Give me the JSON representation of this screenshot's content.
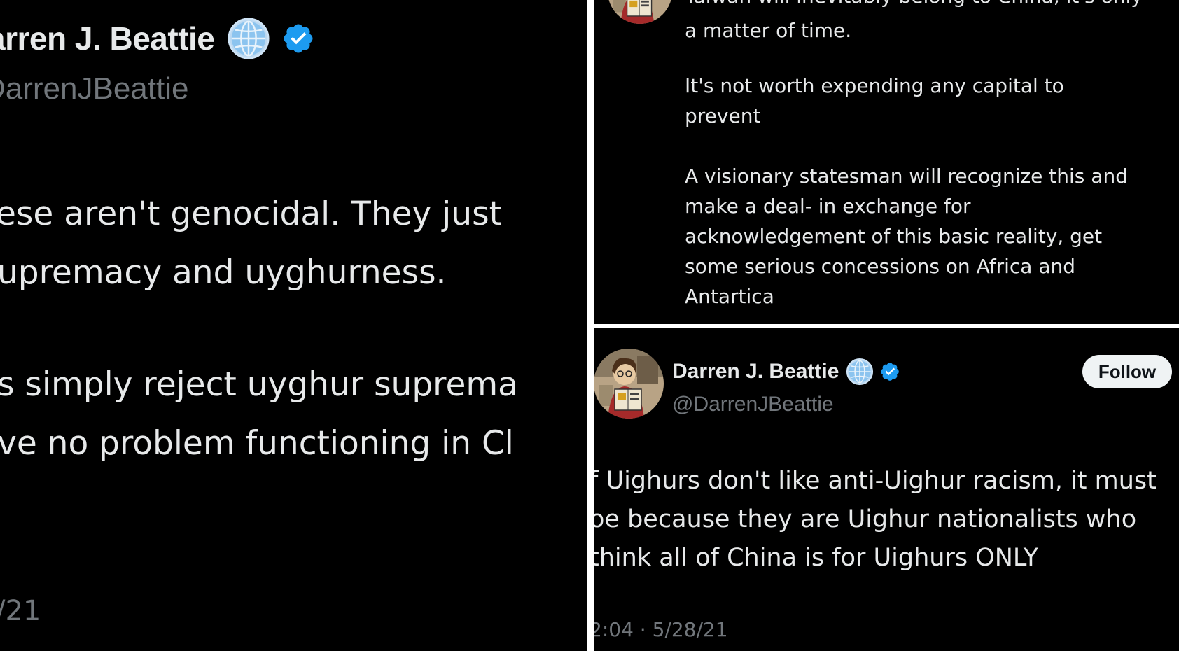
{
  "colors": {
    "background": "#000000",
    "text": "#e7e9ea",
    "muted": "#71767b",
    "verified_blue": "#1d9bf0",
    "globe_blue": "#8cc4ef",
    "follow_bg": "#eff3f4",
    "follow_text": "#0f1419"
  },
  "left_tweet": {
    "display_name": "arren J. Beattie",
    "handle": "DarrenJBeattie",
    "lines": [
      "ese aren't genocidal. They just",
      "upremacy and uyghurness.",
      "s simply reject uyghur suprema",
      "ve no problem functioning in Cl"
    ],
    "date": "/21",
    "icons": [
      "globe-icon",
      "verified-badge-icon"
    ]
  },
  "top_right_tweet": {
    "cut_line": "Taiwan will inevitably belong to China, it's only",
    "lines": [
      "a matter of time.",
      " It's not worth expending any capital to",
      "prevent",
      "A visionary statesman will recognize this and",
      "make a deal- in exchange for",
      "acknowledgement of this basic reality, get",
      "some serious concessions on Africa and",
      "Antartica"
    ],
    "icons": [
      "avatar"
    ]
  },
  "bottom_right_tweet": {
    "display_name": "Darren J. Beattie",
    "handle": "@DarrenJBeattie",
    "follow_label": "Follow",
    "lines": [
      "f Uighurs don't like anti-Uighur racism, it must",
      "oe because they are Uighur nationalists who",
      "think all of China is for Uighurs ONLY"
    ],
    "date": "2:04 · 5/28/21",
    "icons": [
      "avatar",
      "globe-icon",
      "verified-badge-icon"
    ]
  }
}
